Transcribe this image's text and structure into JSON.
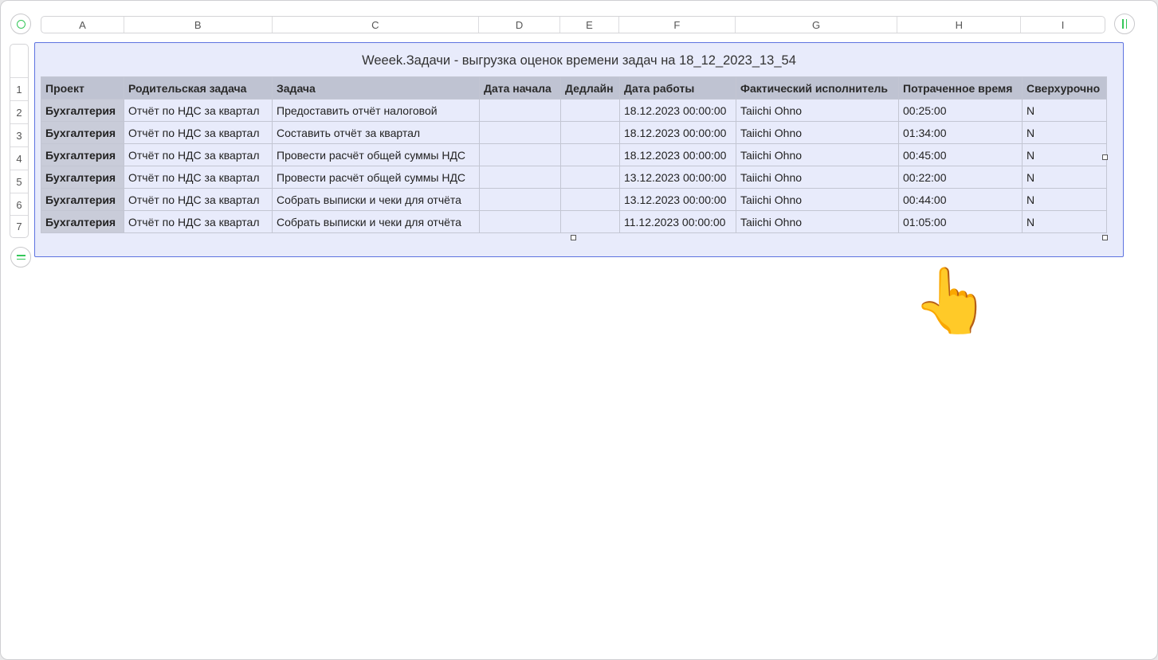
{
  "sheet": {
    "column_letters": [
      "A",
      "B",
      "C",
      "D",
      "E",
      "F",
      "G",
      "H",
      "I"
    ],
    "row_numbers": [
      "1",
      "2",
      "3",
      "4",
      "5",
      "6",
      "7"
    ],
    "table_title": "Weeek.Задачи - выгрузка оценок времени задач на 18_12_2023_13_54",
    "headers": [
      "Проект",
      "Родительская задача",
      "Задача",
      "Дата начала",
      "Дедлайн",
      "Дата работы",
      "Фактический исполнитель",
      "Потраченное время",
      "Сверхурочно"
    ],
    "rows": [
      [
        "Бухгалтерия",
        "Отчёт по НДС за квартал",
        "Предоставить отчёт налоговой",
        "",
        "",
        "18.12.2023 00:00:00",
        "Taiichi Ohno",
        "00:25:00",
        "N"
      ],
      [
        "Бухгалтерия",
        "Отчёт по НДС за квартал",
        "Составить отчёт за квартал",
        "",
        "",
        "18.12.2023 00:00:00",
        "Taiichi Ohno",
        "01:34:00",
        "N"
      ],
      [
        "Бухгалтерия",
        "Отчёт по НДС за квартал",
        "Провести расчёт общей суммы НДС",
        "",
        "",
        "18.12.2023 00:00:00",
        "Taiichi Ohno",
        "00:45:00",
        "N"
      ],
      [
        "Бухгалтерия",
        "Отчёт по НДС за квартал",
        "Провести расчёт общей суммы НДС",
        "",
        "",
        "13.12.2023 00:00:00",
        "Taiichi Ohno",
        "00:22:00",
        "N"
      ],
      [
        "Бухгалтерия",
        "Отчёт по НДС за квартал",
        "Собрать выписки и чеки для отчёта",
        "",
        "",
        "13.12.2023 00:00:00",
        "Taiichi Ohno",
        "00:44:00",
        "N"
      ],
      [
        "Бухгалтерия",
        "Отчёт по НДС за квартал",
        "Собрать выписки и чеки для отчёта",
        "",
        "",
        "11.12.2023 00:00:00",
        "Taiichi Ohno",
        "01:05:00",
        "N"
      ]
    ]
  },
  "icons": {
    "select_table": "circle-icon",
    "add_row": "equals-icon",
    "add_column": "pause-bars-icon",
    "cursor": "pointing-hand-icon"
  },
  "cursor_glyph": "👆",
  "colors": {
    "selection_border": "#5d73e0",
    "table_fill": "#e8ebfb",
    "header_fill": "#bfc3d2",
    "accent_green": "#34c759"
  }
}
